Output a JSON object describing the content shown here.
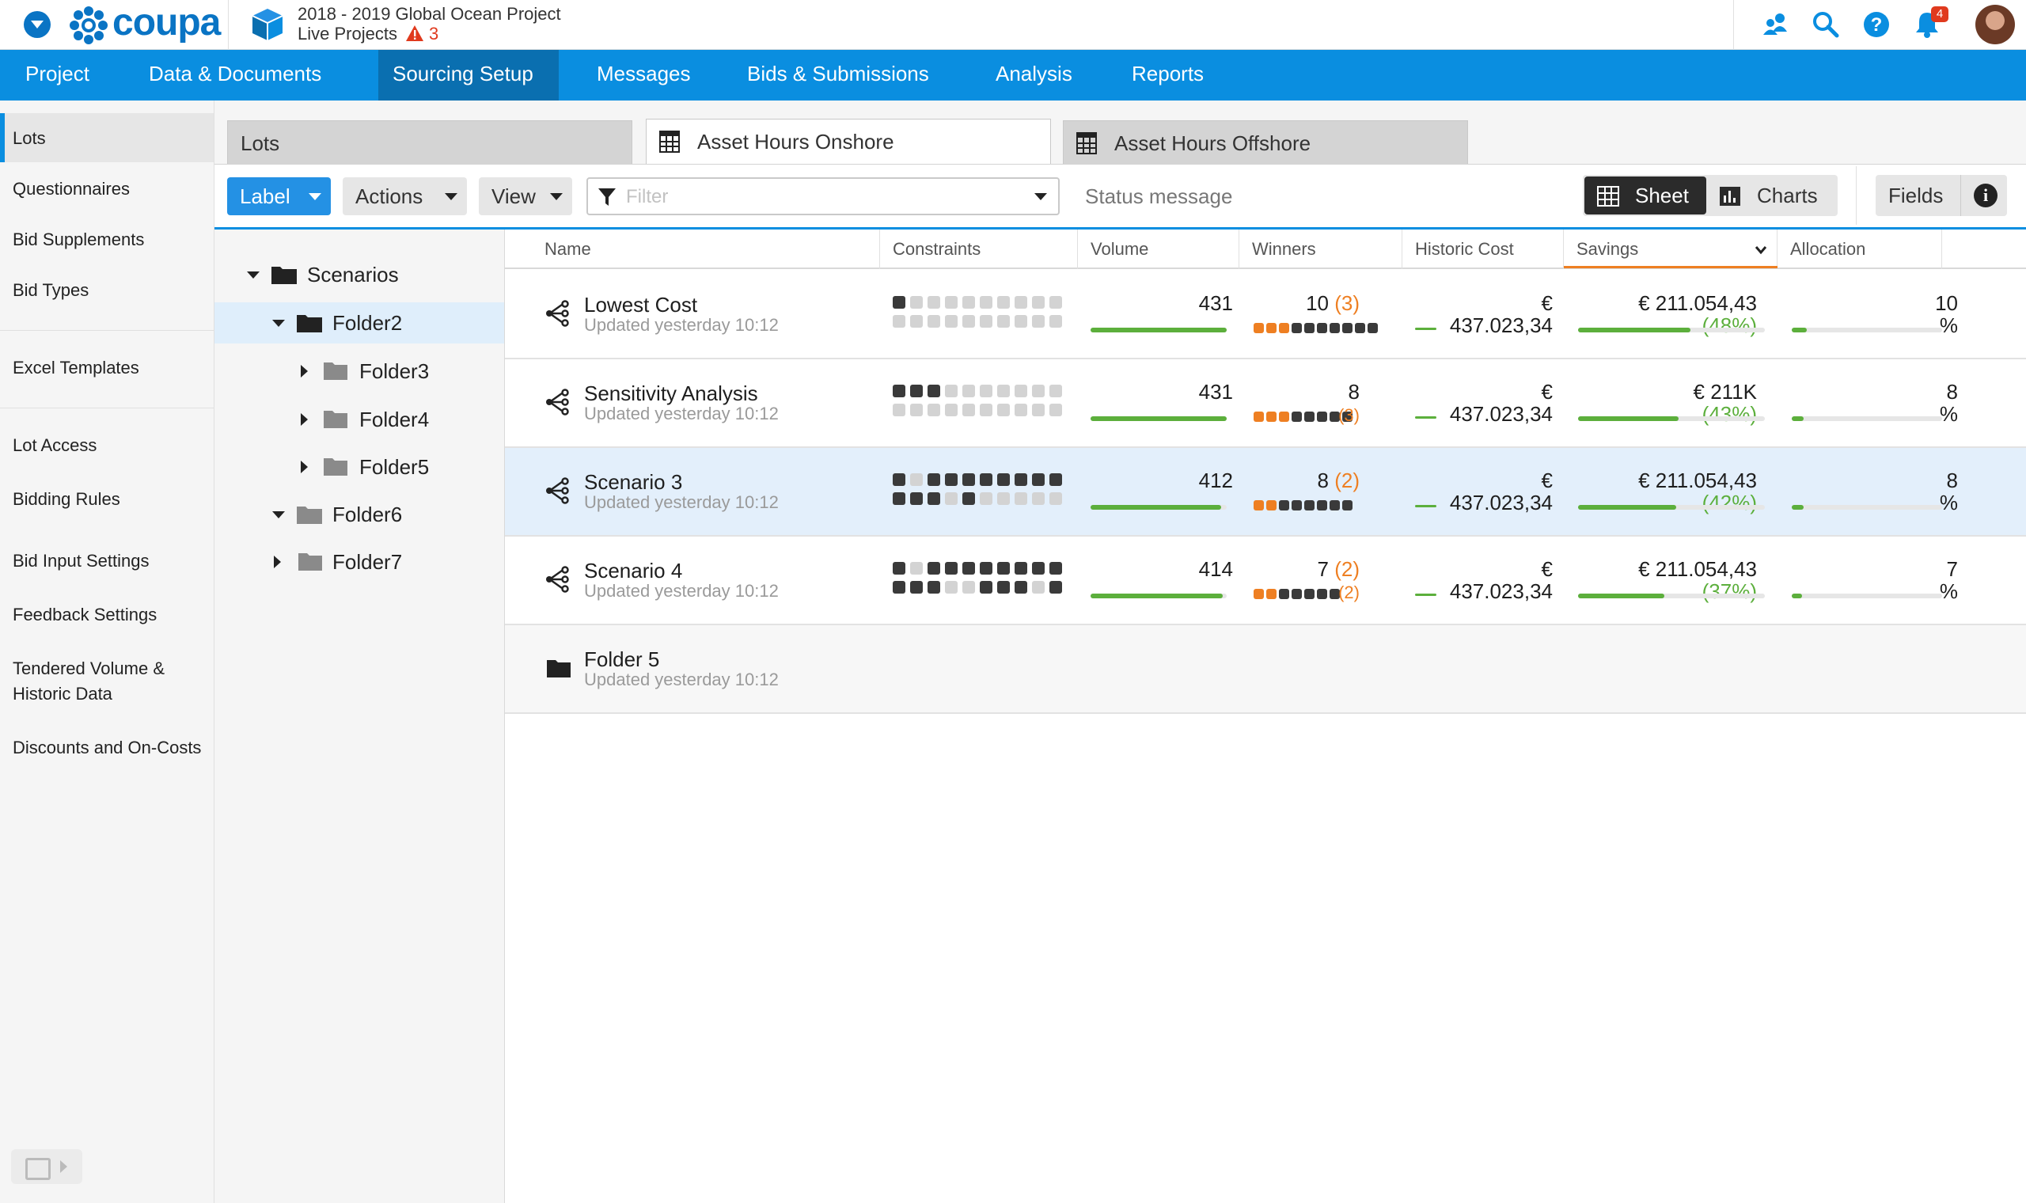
{
  "app": {
    "logo_text": "coupa",
    "project_title": "2018 - 2019 Global Ocean Project",
    "project_sub": "Live Projects",
    "warning_count": "3",
    "notification_count": "4",
    "icons": [
      "menu-icon",
      "coupa-logo-icon",
      "project-cube-icon",
      "warning-icon",
      "people-icon",
      "search-icon",
      "help-icon",
      "bell-icon",
      "avatar"
    ],
    "colors": {
      "brand": "#0a74c4",
      "nav": "#0a8ee0",
      "nav_active": "#0a6fb0",
      "accent_orange": "#ee7f22",
      "positive_green": "#5caf3c"
    }
  },
  "nav": {
    "items": [
      "Project",
      "Data & Documents",
      "Sourcing Setup",
      "Messages",
      "Bids & Submissions",
      "Analysis",
      "Reports"
    ],
    "active": "Sourcing Setup"
  },
  "sidebar": {
    "items": [
      "Lots",
      "Questionnaires",
      "Bid Supplements",
      "Bid Types",
      "Excel Templates",
      "Lot Access",
      "Bidding Rules",
      "Bid Input Settings",
      "Feedback Settings",
      "Tendered Volume & Historic Data",
      "Discounts and On-Costs"
    ],
    "active": "Lots"
  },
  "tabs": [
    "Lots",
    "Asset Hours Onshore",
    "Asset Hours Offshore"
  ],
  "active_tab": "Asset Hours Onshore",
  "toolbar": {
    "label_btn": "Label",
    "actions_btn": "Actions",
    "view_btn": "View",
    "filter_placeholder": "Filter",
    "status_message": "Status message",
    "sheet": "Sheet",
    "charts": "Charts",
    "fields": "Fields",
    "info": "i"
  },
  "tree": {
    "root": "Scenarios",
    "items": [
      "Folder2",
      "Folder3",
      "Folder4",
      "Folder5",
      "Folder6",
      "Folder7"
    ],
    "selected": "Folder2"
  },
  "grid": {
    "columns": [
      "Name",
      "Constraints",
      "Volume",
      "Winners",
      "Historic Cost",
      "Savings",
      "Allocation"
    ],
    "sorted_column": "Savings",
    "rows": [
      {
        "name": "Lowest Cost",
        "updated": "Updated yesterday 10:12",
        "constraints_top": [
          1,
          0,
          0,
          0,
          0,
          0,
          0,
          0,
          0,
          0
        ],
        "constraints_bottom": [
          0,
          0,
          0,
          0,
          0,
          0,
          0,
          0,
          0,
          0
        ],
        "volume": "431",
        "volume_pct": 1.0,
        "winners": "10",
        "winners_extra": "(3)",
        "winner_dots": [
          "o",
          "o",
          "o",
          "d",
          "d",
          "d",
          "d",
          "d",
          "d",
          "d"
        ],
        "historic_cost_a": "€",
        "historic_cost_b": "437.023,34",
        "historic_pct": 0.15,
        "savings": "€ 211.054,43",
        "savings_pct_text": "(48%)",
        "savings_pct": 0.48,
        "allocation_a": "10",
        "allocation_b": "%",
        "allocation_pct": 0.1
      },
      {
        "name": "Sensitivity Analysis",
        "updated": "Updated yesterday 10:12",
        "constraints_top": [
          1,
          1,
          1,
          0,
          0,
          0,
          0,
          0,
          0,
          0
        ],
        "constraints_bottom": [
          0,
          0,
          0,
          0,
          0,
          0,
          0,
          0,
          0,
          0
        ],
        "volume": "431",
        "volume_pct": 1.0,
        "winners": "8",
        "winners_extra": "(3)",
        "winner_dots": [
          "o",
          "o",
          "o",
          "d",
          "d",
          "d",
          "d",
          "d"
        ],
        "historic_cost_a": "€",
        "historic_cost_b": "437.023,34",
        "historic_pct": 0.15,
        "savings": "€ 211K",
        "savings_pct_text": "(43%)",
        "savings_pct": 0.43,
        "allocation_a": "8",
        "allocation_b": "%",
        "allocation_pct": 0.08
      },
      {
        "name": "Scenario 3",
        "updated": "Updated yesterday 10:12",
        "constraints_top": [
          1,
          0,
          1,
          1,
          1,
          1,
          1,
          1,
          1,
          1
        ],
        "constraints_bottom": [
          1,
          1,
          1,
          0,
          1,
          0,
          0,
          0,
          0,
          0
        ],
        "volume": "412",
        "volume_pct": 0.96,
        "winners": "8",
        "winners_extra": "(2)",
        "winner_dots": [
          "o",
          "o",
          "d",
          "d",
          "d",
          "d",
          "d",
          "d"
        ],
        "historic_cost_a": "€",
        "historic_cost_b": "437.023,34",
        "historic_pct": 0.15,
        "savings": "€ 211.054,43",
        "savings_pct_text": "(42%)",
        "savings_pct": 0.42,
        "allocation_a": "8",
        "allocation_b": "%",
        "allocation_pct": 0.08
      },
      {
        "name": "Scenario 4",
        "updated": "Updated yesterday 10:12",
        "constraints_top": [
          1,
          0,
          1,
          1,
          1,
          1,
          1,
          1,
          1,
          1
        ],
        "constraints_bottom": [
          1,
          1,
          1,
          0,
          0,
          1,
          1,
          1,
          0,
          1
        ],
        "volume": "414",
        "volume_pct": 0.97,
        "winners": "7",
        "winners_extra": "(2)",
        "winner_dots": [
          "o",
          "o",
          "d",
          "d",
          "d",
          "d",
          "d"
        ],
        "historic_cost_a": "€",
        "historic_cost_b": "437.023,34",
        "historic_pct": 0.15,
        "savings": "€ 211.054,43",
        "savings_pct_text": "(37%)",
        "savings_pct": 0.37,
        "allocation_a": "7",
        "allocation_b": "%",
        "allocation_pct": 0.07
      }
    ],
    "folder_row": {
      "name": "Folder 5",
      "updated": "Updated yesterday 10:12"
    }
  }
}
